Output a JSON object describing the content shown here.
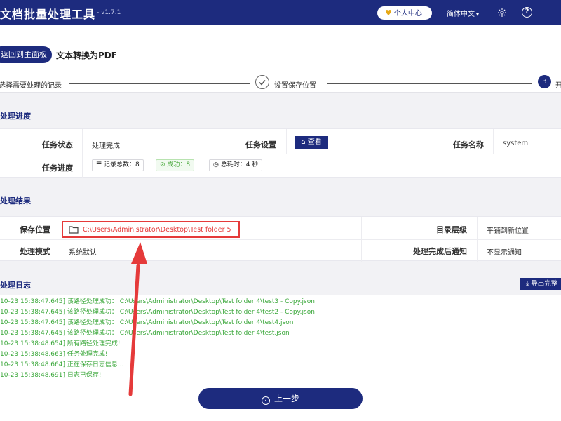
{
  "header": {
    "app_title": "文档批量处理工具",
    "version": "- v1.7.1",
    "user_center": "个人中心",
    "language": "简体中文"
  },
  "nav": {
    "back_label": "返回到主面板",
    "page_title": "文本转换为PDF"
  },
  "steps": [
    {
      "label": "选择需要处理的记录"
    },
    {
      "label": "设置保存位置"
    },
    {
      "number": "3",
      "label": "开"
    }
  ],
  "progress_section": {
    "title": "处理进度",
    "task_status_label": "任务状态",
    "task_status_value": "处理完成",
    "task_settings_label": "任务设置",
    "view_button": "查看",
    "task_name_label": "任务名称",
    "task_name_value": "system",
    "task_progress_label": "任务进度",
    "chip_total": "记录总数：8",
    "chip_success": "成功：8",
    "chip_time": "总耗时：4 秒"
  },
  "result_section": {
    "title": "处理结果",
    "save_location_label": "保存位置",
    "save_location_value": "C:\\Users\\Administrator\\Desktop\\Test folder 5",
    "dir_level_label": "目录层级",
    "dir_level_value": "平铺到新位置",
    "mode_label": "处理模式",
    "mode_value": "系统默认",
    "notify_label": "处理完成后通知",
    "notify_value": "不显示通知"
  },
  "log_section": {
    "title": "处理日志",
    "export_button": "导出完整",
    "lines": [
      "10-23 15:38:47.645] 该路径处理成功： C:\\Users\\Administrator\\Desktop\\Test folder 4\\test3 - Copy.json",
      "10-23 15:38:47.645] 该路径处理成功： C:\\Users\\Administrator\\Desktop\\Test folder 4\\test2 - Copy.json",
      "10-23 15:38:47.645] 该路径处理成功： C:\\Users\\Administrator\\Desktop\\Test folder 4\\test4.json",
      "10-23 15:38:47.645] 该路径处理成功： C:\\Users\\Administrator\\Desktop\\Test folder 4\\test.json",
      "10-23 15:38:48.654] 所有路径处理完成!",
      "10-23 15:38:48.663] 任务处理完成!",
      "10-23 15:38:48.664] 正在保存日志信息...",
      "10-23 15:38:48.691] 日志已保存!"
    ]
  },
  "footer": {
    "prev_button": "上一步"
  },
  "colors": {
    "brand": "#1d2b7e",
    "log_text": "#3aa73a",
    "highlight": "#e53a3a"
  }
}
